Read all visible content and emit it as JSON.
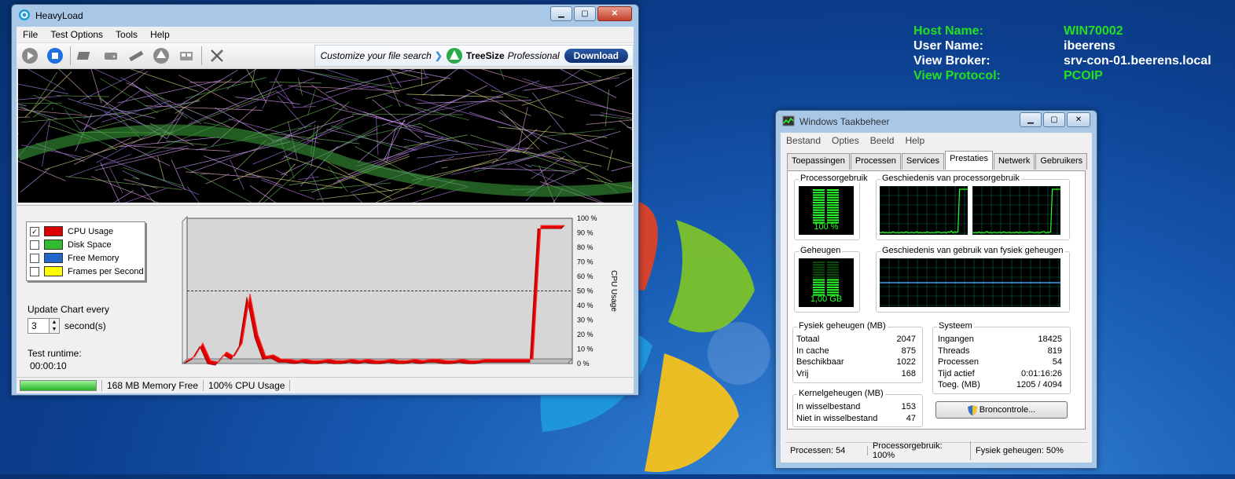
{
  "bginfo": {
    "rows": [
      {
        "key": "Host Name:",
        "value": "WIN70002",
        "color": "#22e022"
      },
      {
        "key": "User Name:",
        "value": "ibeerens",
        "color": "#ffffff"
      },
      {
        "key": "View Broker:",
        "value": "srv-con-01.beerens.local",
        "color": "#ffffff"
      },
      {
        "key": "View Protocol:",
        "value": "PCOIP",
        "color": "#22e022"
      }
    ]
  },
  "heavyload": {
    "title": "HeavyLoad",
    "menu": [
      "File",
      "Test Options",
      "Tools",
      "Help"
    ],
    "toolbar_icons": [
      "play-icon",
      "stop-icon",
      "cpu-icon",
      "disk-icon",
      "memory-icon",
      "gpu-icon",
      "ram-icon",
      "tools-icon"
    ],
    "promo": {
      "text": "Customize your file search",
      "brand": "TreeSize",
      "edition": "Professional",
      "button": "Download"
    },
    "legend": [
      {
        "label": "CPU Usage",
        "color": "#dd0000",
        "checked": true
      },
      {
        "label": "Disk Space",
        "color": "#33bb33",
        "checked": false
      },
      {
        "label": "Free Memory",
        "color": "#2266cc",
        "checked": false
      },
      {
        "label": "Frames per Second",
        "color": "#ffff00",
        "checked": false
      }
    ],
    "update_label": "Update Chart every",
    "update_value": "3",
    "update_unit": "second(s)",
    "runtime_label": "Test runtime:",
    "runtime_value": "00:00:10",
    "status": {
      "memory": "168 MB Memory Free",
      "cpu": "100% CPU Usage"
    }
  },
  "chart_data": {
    "type": "line",
    "title": "",
    "ylabel": "CPU Usage",
    "ylim": [
      0,
      100
    ],
    "yticks": [
      "100 %",
      "90 %",
      "80 %",
      "70 %",
      "60 %",
      "50 %",
      "40 %",
      "30 %",
      "20 %",
      "10 %",
      "0 %"
    ],
    "reference_line": 50,
    "series": [
      {
        "color": "#dd0000",
        "values": [
          2,
          5,
          14,
          2,
          1,
          8,
          5,
          14,
          48,
          20,
          5,
          6,
          3,
          3,
          2,
          3,
          2,
          2,
          3,
          2,
          2,
          3,
          2,
          3,
          2,
          2,
          3,
          2,
          2,
          3,
          2,
          3,
          3,
          2,
          2,
          3,
          2,
          2,
          3,
          3,
          3,
          3,
          3,
          3,
          3,
          95,
          95,
          95,
          95
        ]
      }
    ]
  },
  "taskmgr": {
    "title": "Windows Taakbeheer",
    "menu": [
      "Bestand",
      "Opties",
      "Beeld",
      "Help"
    ],
    "tabs": [
      "Toepassingen",
      "Processen",
      "Services",
      "Prestaties",
      "Netwerk",
      "Gebruikers"
    ],
    "active_tab": "Prestaties",
    "cpu_label": "Processorgebruik",
    "cpu_value": "100 %",
    "cpu_hist_label": "Geschiedenis van processorgebruik",
    "mem_label": "Geheugen",
    "mem_value": "1,00 GB",
    "mem_hist_label": "Geschiedenis van gebruik van fysiek geheugen",
    "physical": {
      "label": "Fysiek geheugen (MB)",
      "rows": [
        [
          "Totaal",
          "2047"
        ],
        [
          "In cache",
          "875"
        ],
        [
          "Beschikbaar",
          "1022"
        ],
        [
          "Vrij",
          "168"
        ]
      ]
    },
    "system": {
      "label": "Systeem",
      "rows": [
        [
          "Ingangen",
          "18425"
        ],
        [
          "Threads",
          "819"
        ],
        [
          "Processen",
          "54"
        ],
        [
          "Tijd actief",
          "0:01:16:26"
        ],
        [
          "Toeg. (MB)",
          "1205 / 4094"
        ]
      ]
    },
    "kernel": {
      "label": "Kernelgeheugen (MB)",
      "rows": [
        [
          "In wisselbestand",
          "153"
        ],
        [
          "Niet in wisselbestand",
          "47"
        ]
      ]
    },
    "resource_button": "Broncontrole...",
    "status": {
      "processes": "Processen: 54",
      "cpu": "Processorgebruik: 100%",
      "memory": "Fysiek geheugen: 50%"
    },
    "cpu_hist_core1": [
      2,
      1,
      3,
      1,
      2,
      1,
      2,
      1,
      3,
      2,
      1,
      2,
      1,
      2,
      2,
      1,
      3,
      2,
      1,
      2,
      2,
      1,
      2,
      3,
      1,
      2,
      1,
      2,
      1,
      3,
      2,
      1,
      2,
      1,
      2,
      2,
      3,
      2,
      1,
      2,
      2,
      1,
      3,
      2,
      5,
      1,
      3,
      2,
      3,
      100,
      100,
      100,
      100,
      100,
      100
    ],
    "cpu_hist_core2": [
      2,
      1,
      2,
      1,
      3,
      1,
      2,
      1,
      2,
      4,
      1,
      2,
      1,
      2,
      2,
      1,
      2,
      2,
      1,
      3,
      2,
      1,
      2,
      2,
      1,
      2,
      1,
      3,
      1,
      2,
      2,
      1,
      2,
      1,
      2,
      3,
      2,
      2,
      1,
      2,
      2,
      1,
      2,
      3,
      4,
      1,
      2,
      2,
      3,
      100,
      100,
      100,
      100,
      100,
      100
    ],
    "mem_usage": 50
  }
}
